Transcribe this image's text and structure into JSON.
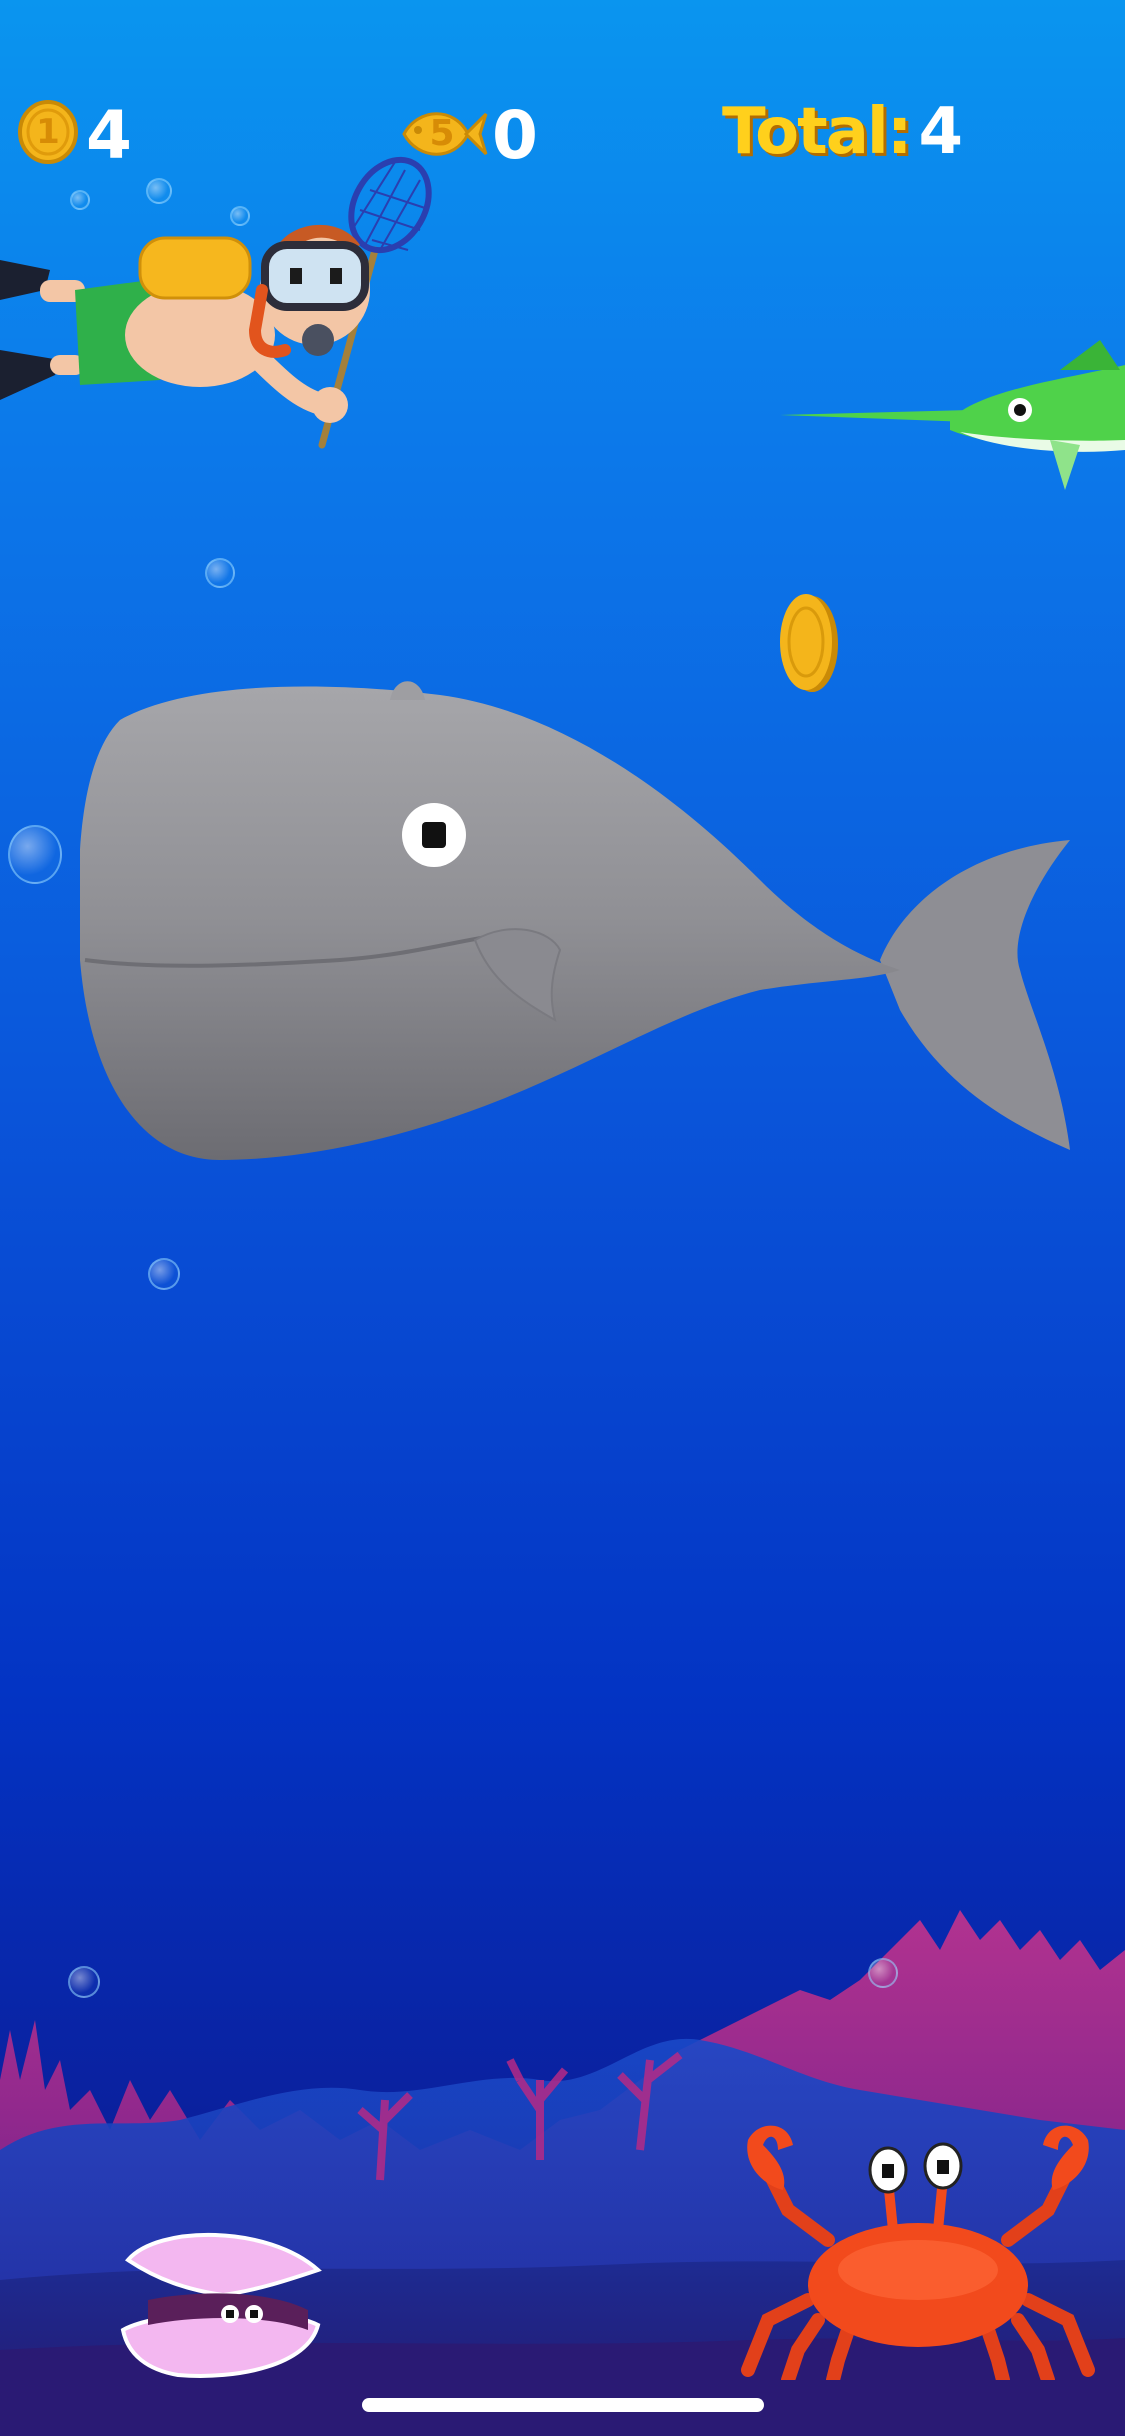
{
  "hud": {
    "coin_badge_value": "1",
    "coins_count": "4",
    "fish_badge_value": "5",
    "fish_count": "0",
    "total_label": "Total:",
    "total_value": "4"
  },
  "colors": {
    "water_top": "#0a95ef",
    "water_bottom": "#150f68",
    "coin_gold": "#f4b51b",
    "total_yellow": "#ffd01c",
    "whale_gray": "#9a9a9e",
    "swordfish_green": "#4fd24a",
    "crab_red": "#f24a1c",
    "clam_pink": "#f3b7f0",
    "diver_shorts": "#2fb04a",
    "diver_tank": "#f6b71e"
  },
  "entities": {
    "diver": "diver-with-net",
    "whale": "whale",
    "swordfish": "swordfish",
    "coin": "gold-coin",
    "crab": "crab",
    "clam": "clam"
  }
}
